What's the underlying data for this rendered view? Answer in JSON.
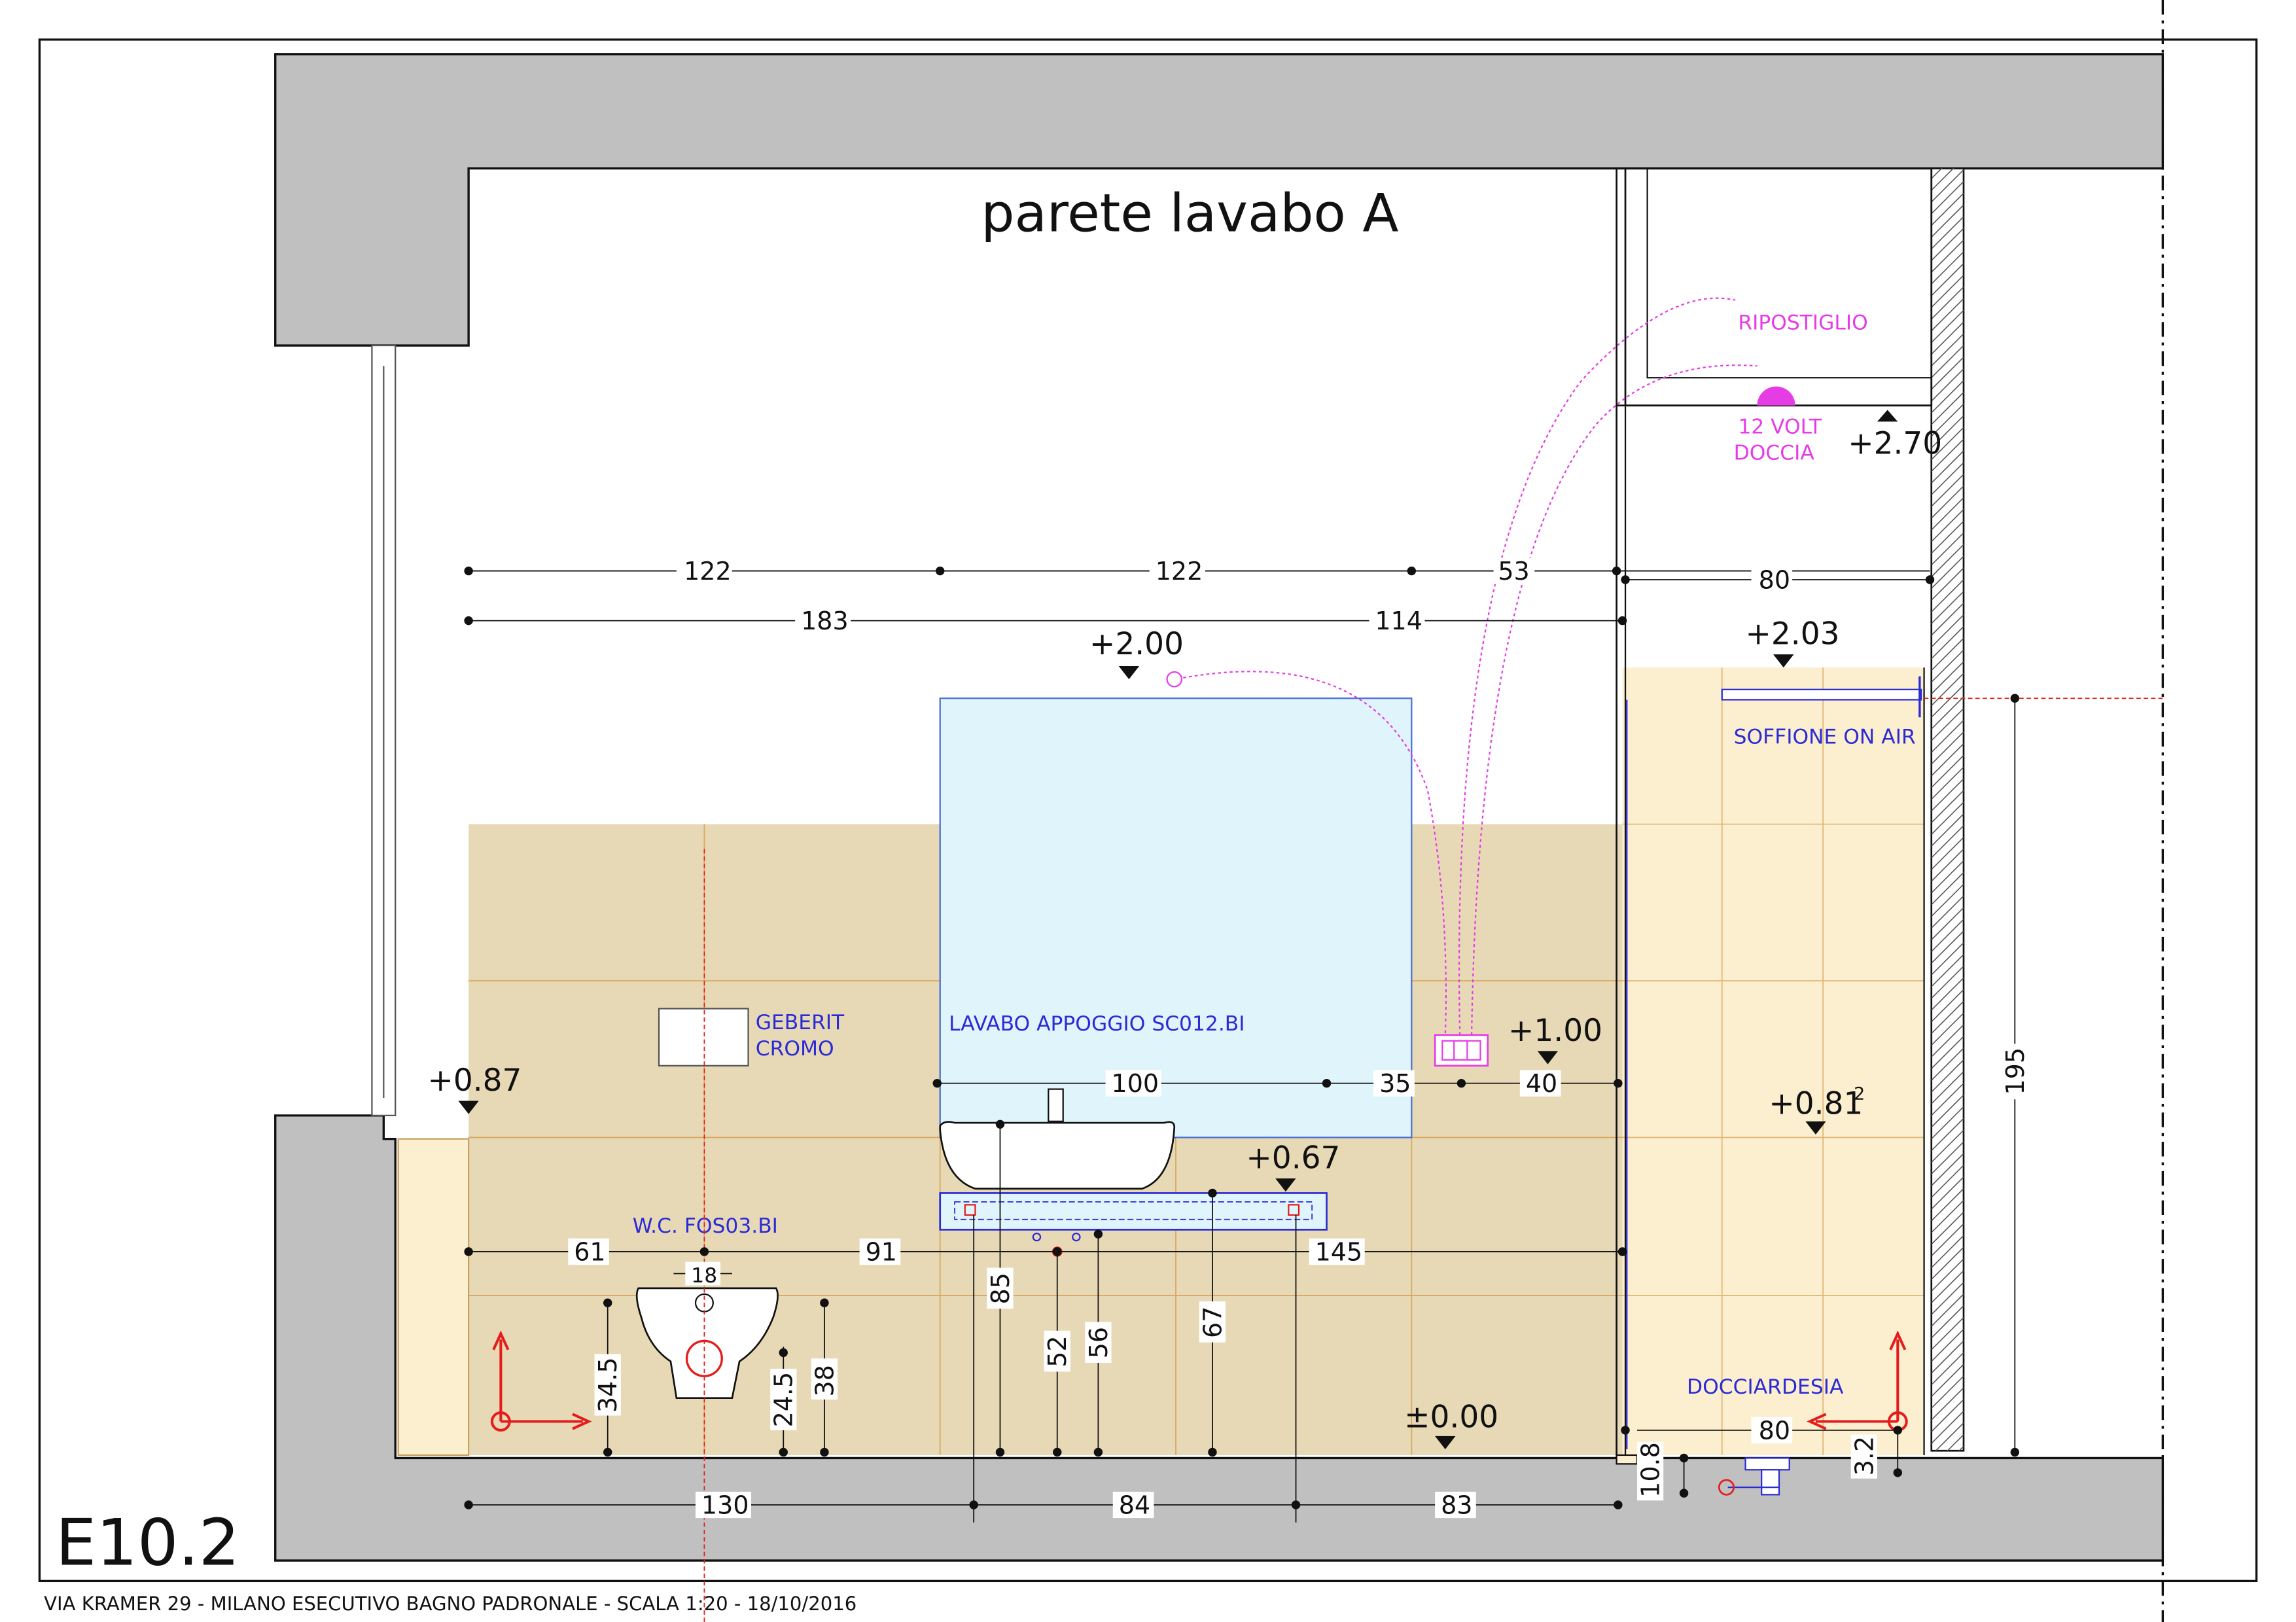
{
  "sheet": {
    "title": "parete lavabo A",
    "code": "E10.2",
    "footer": "VIA KRAMER 29 - MILANO ESECUTIVO BAGNO PADRONALE - SCALA 1:20 - 18/10/2016"
  },
  "colors": {
    "wall": "#c0c0c0",
    "tile": "#e8d9b6",
    "shower_tile": "#fcefcf",
    "mirror": "#e0f4fc",
    "blue_text": "#2b2bd6",
    "magenta": "#e63ce6",
    "red_marker": "#e41c1c"
  },
  "labels": {
    "geberit_1": "GEBERIT",
    "geberit_2": "CROMO",
    "lavabo": "LAVABO APPOGGIO SC012.BI",
    "wc": "W.C. FOS03.BI",
    "soffione": "SOFFIONE ON AIR",
    "docciardesia": "DOCCIARDESIA",
    "ripostiglio": "RIPOSTIGLIO",
    "volt_1": "12 VOLT",
    "volt_2": "DOCCIA"
  },
  "levels": {
    "l270": "+2.70",
    "l200": "+2.00",
    "l203": "+2.03",
    "l100": "+1.00",
    "l087": "+0.87",
    "l081": "+0.81",
    "l081_sup": "2",
    "l067": "+0.67",
    "l000": "±0.00"
  },
  "dims": {
    "top_122a": "122",
    "top_122b": "122",
    "top_53": "53",
    "top_80": "80",
    "row2_183": "183",
    "row2_114": "114",
    "mid_100": "100",
    "mid_35": "35",
    "mid_40": "40",
    "wc_61": "61",
    "wc_18": "18",
    "mid_91": "91",
    "mid_145": "145",
    "v_345": "34.5",
    "v_245": "24.5",
    "v_38": "38",
    "v_85": "85",
    "v_52": "52",
    "v_56": "56",
    "v_67": "67",
    "v_195": "195",
    "shower_80": "80",
    "v_108": "10.8",
    "v_32": "3.2",
    "bot_130": "130",
    "bot_84": "84",
    "bot_83": "83"
  }
}
